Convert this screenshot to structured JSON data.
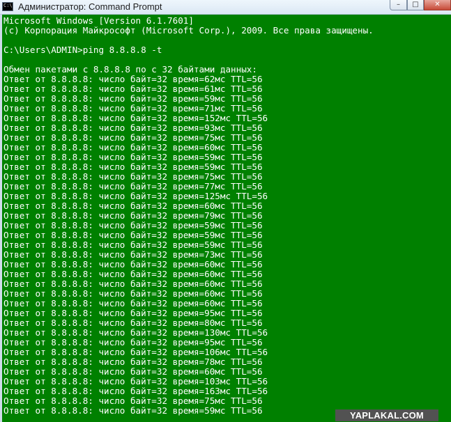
{
  "window": {
    "title": "Администратор: Command Prompt",
    "app_icon_glyph": "C:\\",
    "controls": {
      "minimize": "–",
      "maximize": "□",
      "close": "✕"
    }
  },
  "console": {
    "background_color": "#008000",
    "text_color": "#ffffff",
    "lines": [
      "Microsoft Windows [Version 6.1.7601]",
      "(c) Корпорация Майкрософт (Microsoft Corp.), 2009. Все права защищены.",
      "",
      "C:\\Users\\ADMIN>ping 8.8.8.8 -t",
      "",
      "Обмен пакетами с 8.8.8.8 по с 32 байтами данных:",
      "Ответ от 8.8.8.8: число байт=32 время=62мс TTL=56",
      "Ответ от 8.8.8.8: число байт=32 время=61мс TTL=56",
      "Ответ от 8.8.8.8: число байт=32 время=59мс TTL=56",
      "Ответ от 8.8.8.8: число байт=32 время=71мс TTL=56",
      "Ответ от 8.8.8.8: число байт=32 время=152мс TTL=56",
      "Ответ от 8.8.8.8: число байт=32 время=93мс TTL=56",
      "Ответ от 8.8.8.8: число байт=32 время=75мс TTL=56",
      "Ответ от 8.8.8.8: число байт=32 время=60мс TTL=56",
      "Ответ от 8.8.8.8: число байт=32 время=59мс TTL=56",
      "Ответ от 8.8.8.8: число байт=32 время=59мс TTL=56",
      "Ответ от 8.8.8.8: число байт=32 время=75мс TTL=56",
      "Ответ от 8.8.8.8: число байт=32 время=77мс TTL=56",
      "Ответ от 8.8.8.8: число байт=32 время=125мс TTL=56",
      "Ответ от 8.8.8.8: число байт=32 время=60мс TTL=56",
      "Ответ от 8.8.8.8: число байт=32 время=79мс TTL=56",
      "Ответ от 8.8.8.8: число байт=32 время=59мс TTL=56",
      "Ответ от 8.8.8.8: число байт=32 время=59мс TTL=56",
      "Ответ от 8.8.8.8: число байт=32 время=59мс TTL=56",
      "Ответ от 8.8.8.8: число байт=32 время=73мс TTL=56",
      "Ответ от 8.8.8.8: число байт=32 время=60мс TTL=56",
      "Ответ от 8.8.8.8: число байт=32 время=60мс TTL=56",
      "Ответ от 8.8.8.8: число байт=32 время=60мс TTL=56",
      "Ответ от 8.8.8.8: число байт=32 время=60мс TTL=56",
      "Ответ от 8.8.8.8: число байт=32 время=60мс TTL=56",
      "Ответ от 8.8.8.8: число байт=32 время=95мс TTL=56",
      "Ответ от 8.8.8.8: число байт=32 время=80мс TTL=56",
      "Ответ от 8.8.8.8: число байт=32 время=130мс TTL=56",
      "Ответ от 8.8.8.8: число байт=32 время=95мс TTL=56",
      "Ответ от 8.8.8.8: число байт=32 время=106мс TTL=56",
      "Ответ от 8.8.8.8: число байт=32 время=78мс TTL=56",
      "Ответ от 8.8.8.8: число байт=32 время=60мс TTL=56",
      "Ответ от 8.8.8.8: число байт=32 время=103мс TTL=56",
      "Ответ от 8.8.8.8: число байт=32 время=163мс TTL=56",
      "Ответ от 8.8.8.8: число байт=32 время=75мс TTL=56",
      "Ответ от 8.8.8.8: число байт=32 время=59мс TTL=56"
    ]
  },
  "watermark": {
    "text": "YAPLAKAL.COM"
  }
}
